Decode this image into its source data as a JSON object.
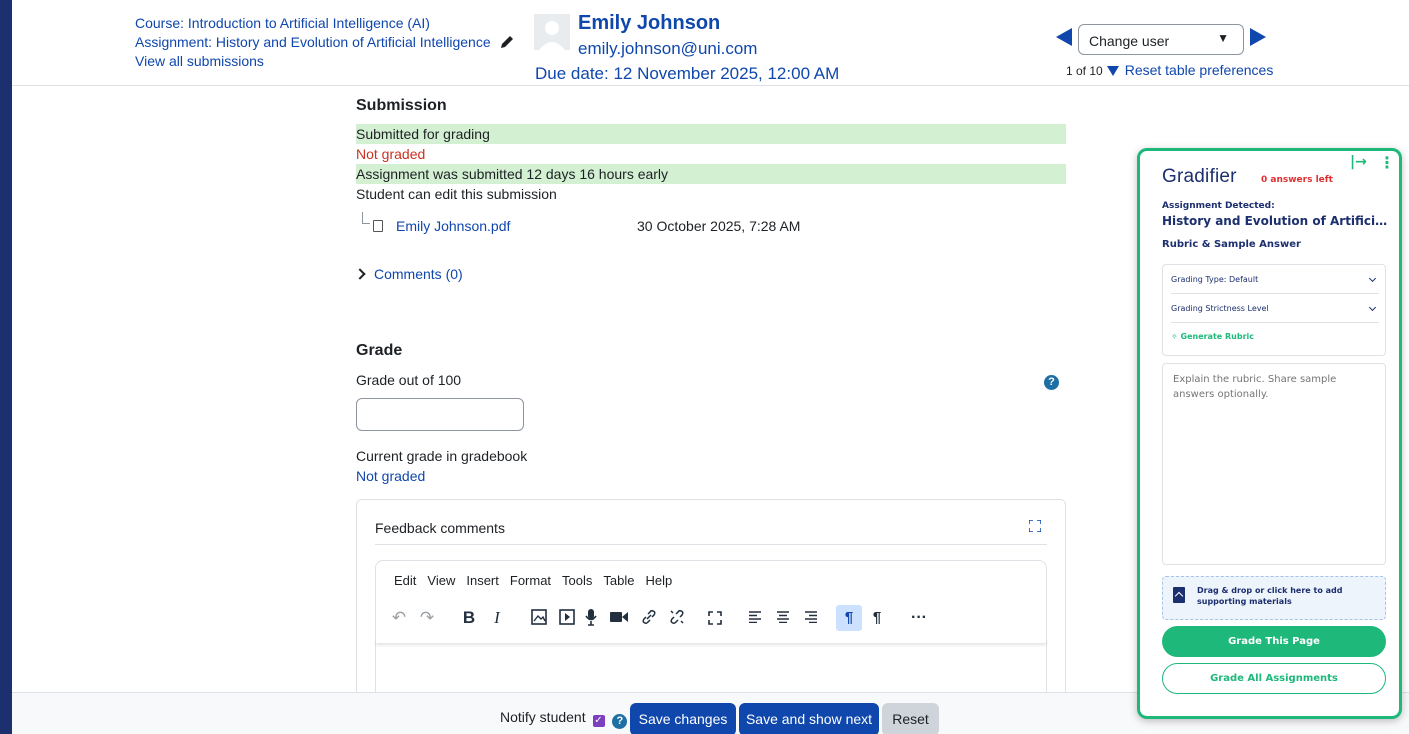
{
  "header": {
    "course_link": "Course: Introduction to Artificial Intelligence (AI)",
    "assignment_link": "Assignment: History and Evolution of Artificial Intelligence",
    "view_all_link": "View all submissions",
    "user_name": "Emily Johnson",
    "user_email": "emily.johnson@uni.com",
    "due_date": "Due date: 12 November 2025, 12:00 AM",
    "change_user_placeholder": "Change user",
    "user_position": "1 of 10",
    "reset_prefs_link": "Reset table preferences"
  },
  "submission": {
    "title": "Submission",
    "status_submitted": "Submitted for grading",
    "status_grading": "Not graded",
    "timing": "Assignment was submitted 12 days 16 hours early",
    "edit_status": "Student can edit this submission",
    "file_name": "Emily Johnson.pdf",
    "file_date": "30 October 2025, 7:28 AM",
    "comments_link": "Comments (0)"
  },
  "grade": {
    "title": "Grade",
    "grade_label": "Grade out of 100",
    "grade_value": "",
    "current_label": "Current grade in gradebook",
    "current_value": "Not graded"
  },
  "feedback": {
    "label": "Feedback comments",
    "menu": [
      "Edit",
      "View",
      "Insert",
      "Format",
      "Tools",
      "Table",
      "Help"
    ]
  },
  "footer": {
    "notify_label": "Notify student",
    "save_label": "Save changes",
    "save_next_label": "Save and show next",
    "reset_label": "Reset"
  },
  "gradifier": {
    "logo": "Gradifier",
    "answers_left": "0 answers left",
    "detected_label": "Assignment Detected:",
    "detected_title": "History and Evolution of Artificial Intelligence",
    "rubric_heading": "Rubric & Sample Answer",
    "grading_type": "Grading Type: Default",
    "strictness": "Grading Strictness Level",
    "generate_rubric": "Generate Rubric",
    "rubric_placeholder": "Explain the rubric. Share sample answers optionally.",
    "dropzone_text": "Drag & drop or click here to add supporting materials",
    "grade_page_label": "Grade This Page",
    "grade_all_label": "Grade All Assignments",
    "accent_color": "#1db87a"
  }
}
